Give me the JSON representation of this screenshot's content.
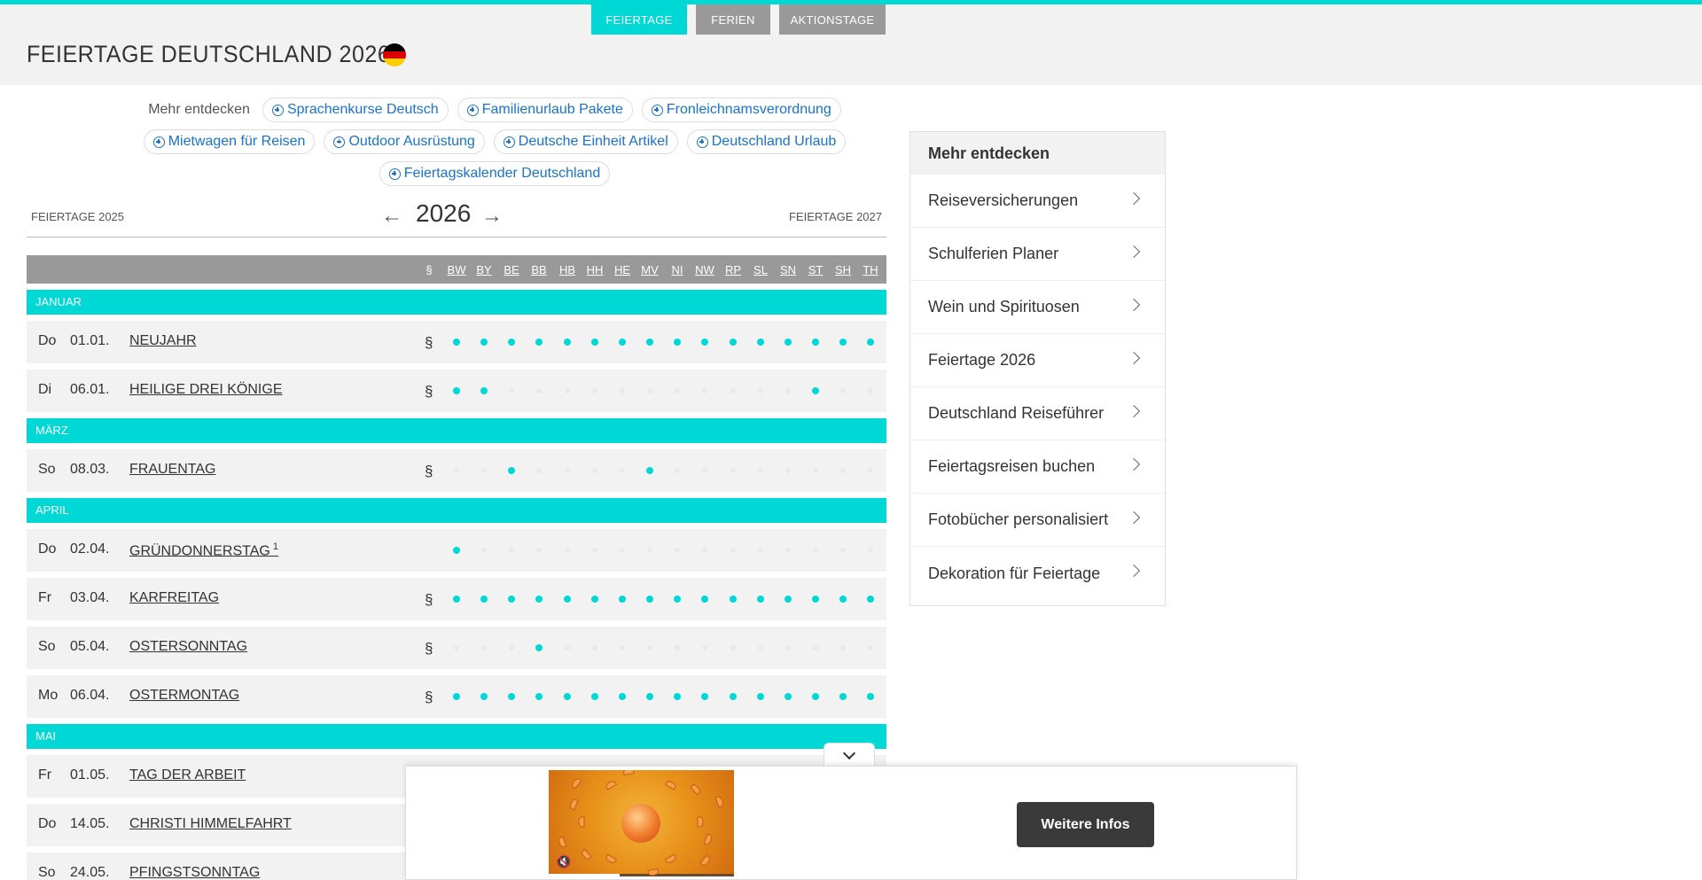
{
  "tabs": [
    {
      "label": "FEIERTAGE",
      "active": true
    },
    {
      "label": "FERIEN",
      "active": false
    },
    {
      "label": "AKTIONSTAGE",
      "active": false
    }
  ],
  "page_title": "FEIERTAGE DEUTSCHLAND 2026",
  "discover": {
    "label": "Mehr entdecken",
    "chips": [
      "Sprachenkurse Deutsch",
      "Familienurlaub Pakete",
      "Fronleichnamsverordnung",
      "Mietwagen für Reisen",
      "Outdoor Ausrüstung",
      "Deutsche Einheit Artikel",
      "Deutschland Urlaub",
      "Feiertagskalender Deutschland"
    ]
  },
  "year_nav": {
    "prev_label": "FEIERTAGE 2025",
    "year": "2026",
    "next_label": "FEIERTAGE 2027"
  },
  "table": {
    "columns": [
      "§",
      "BW",
      "BY",
      "BE",
      "BB",
      "HB",
      "HH",
      "HE",
      "MV",
      "NI",
      "NW",
      "RP",
      "SL",
      "SN",
      "ST",
      "SH",
      "TH"
    ],
    "months": {
      "januar": "JANUAR",
      "maerz": "MÄRZ",
      "april": "APRIL",
      "mai": "MAI"
    },
    "rows": [
      {
        "weekday": "Do",
        "date": "01.01.",
        "name": "NEUJAHR",
        "sup": "",
        "para": "§",
        "states": [
          1,
          1,
          1,
          1,
          1,
          1,
          1,
          1,
          1,
          1,
          1,
          1,
          1,
          1,
          1,
          1
        ]
      },
      {
        "weekday": "Di",
        "date": "06.01.",
        "name": "HEILIGE DREI KÖNIGE",
        "sup": "",
        "para": "§",
        "states": [
          1,
          1,
          0,
          0,
          0,
          0,
          0,
          0,
          0,
          0,
          0,
          0,
          0,
          1,
          0,
          0
        ]
      },
      {
        "weekday": "So",
        "date": "08.03.",
        "name": "FRAUENTAG",
        "sup": "",
        "para": "§",
        "states": [
          0,
          0,
          1,
          0,
          0,
          0,
          0,
          1,
          0,
          0,
          0,
          0,
          0,
          0,
          0,
          0
        ]
      },
      {
        "weekday": "Do",
        "date": "02.04.",
        "name": "GRÜNDONNERSTAG",
        "sup": "1",
        "para": "",
        "states": [
          1,
          0,
          0,
          0,
          0,
          0,
          0,
          0,
          0,
          0,
          0,
          0,
          0,
          0,
          0,
          0
        ]
      },
      {
        "weekday": "Fr",
        "date": "03.04.",
        "name": "KARFREITAG",
        "sup": "",
        "para": "§",
        "states": [
          1,
          1,
          1,
          1,
          1,
          1,
          1,
          1,
          1,
          1,
          1,
          1,
          1,
          1,
          1,
          1
        ]
      },
      {
        "weekday": "So",
        "date": "05.04.",
        "name": "OSTERSONNTAG",
        "sup": "",
        "para": "§",
        "states": [
          0,
          0,
          0,
          1,
          0,
          0,
          0,
          0,
          0,
          0,
          0,
          0,
          0,
          0,
          0,
          0
        ]
      },
      {
        "weekday": "Mo",
        "date": "06.04.",
        "name": "OSTERMONTAG",
        "sup": "",
        "para": "§",
        "states": [
          1,
          1,
          1,
          1,
          1,
          1,
          1,
          1,
          1,
          1,
          1,
          1,
          1,
          1,
          1,
          1
        ]
      },
      {
        "weekday": "Fr",
        "date": "01.05.",
        "name": "TAG DER ARBEIT",
        "sup": "",
        "para": "",
        "states": []
      },
      {
        "weekday": "Do",
        "date": "14.05.",
        "name": "CHRISTI HIMMELFAHRT",
        "sup": "",
        "para": "",
        "states": []
      },
      {
        "weekday": "So",
        "date": "24.05.",
        "name": "PFINGSTSONNTAG",
        "sup": "",
        "para": "",
        "states": []
      }
    ]
  },
  "sidebar": {
    "title": "Mehr entdecken",
    "items": [
      "Reiseversicherungen",
      "Schulferien Planer",
      "Wein und Spirituosen",
      "Feiertage 2026",
      "Deutschland Reiseführer",
      "Feiertagsreisen buchen",
      "Fotobücher personalisiert",
      "Dekoration für Feiertage"
    ]
  },
  "ad": {
    "button_label": "Weitere Infos",
    "mute_icon": "speaker-muted-icon"
  },
  "colors": {
    "accent": "#00d8d6",
    "header_gray": "#999999",
    "row_bg": "#f2f2f2",
    "link_blue": "#1a73c8"
  }
}
